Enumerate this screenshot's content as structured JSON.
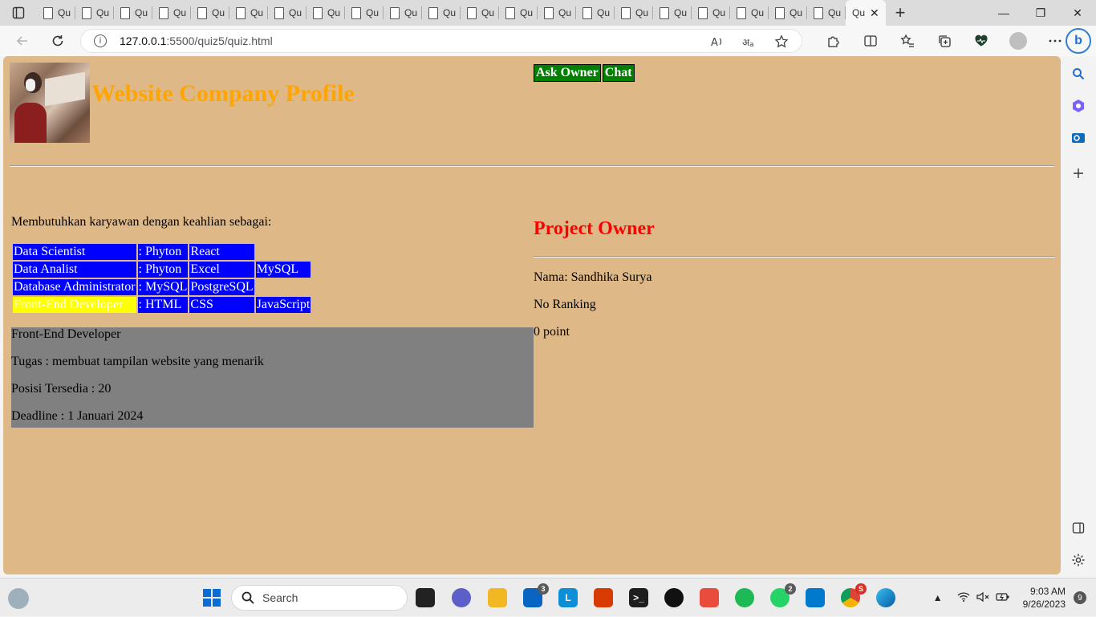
{
  "browser": {
    "tab_label": "Qu",
    "tab_count_inactive": 21,
    "tab_close_glyph": "✕",
    "new_tab_glyph": "+",
    "window": {
      "minimize": "—",
      "restore": "❐",
      "close": "✕"
    },
    "address": {
      "host": "127.0.0.1",
      "path": ":5500/quiz5/quiz.html"
    }
  },
  "page": {
    "title": "Website Company Profile",
    "buttons": {
      "ask_owner": "Ask Owner",
      "chat": "Chat"
    },
    "intro": "Membutuhkan karyawan dengan keahlian sebagai:",
    "skills": [
      {
        "role": "Data Scientist",
        "tools": [
          ": Phyton",
          "React"
        ]
      },
      {
        "role": "Data Analist",
        "tools": [
          ": Phyton",
          "Excel",
          "MySQL"
        ]
      },
      {
        "role": "Database Administrator",
        "tools": [
          ": MySQL",
          "PostgreSQL"
        ]
      },
      {
        "role": "Front-End Developer",
        "tools": [
          ": HTML",
          "CSS",
          "JavaScript"
        ]
      }
    ],
    "detail": {
      "role": "Front-End Developer",
      "task": "Tugas : membuat tampilan website yang menarik",
      "positions": "Posisi Tersedia : 20",
      "deadline": "Deadline : 1 Januari 2024"
    },
    "owner": {
      "heading": "Project Owner",
      "name": "Nama: Sandhika Surya",
      "ranking": "No Ranking",
      "points": "0 point"
    },
    "colors": {
      "background": "#deb887",
      "title": "#ffa500",
      "button": "#008000",
      "owner_heading": "#ff0000",
      "skill_cell": "#0000ff",
      "highlight": "#ffff00",
      "detail_bg": "#808080"
    }
  },
  "taskbar": {
    "search_placeholder": "Search",
    "mail_badge": "3",
    "whatsapp_badge": "2",
    "chrome_badge": "S",
    "time": "9:03 AM",
    "date": "9/26/2023",
    "notifications": "9"
  }
}
